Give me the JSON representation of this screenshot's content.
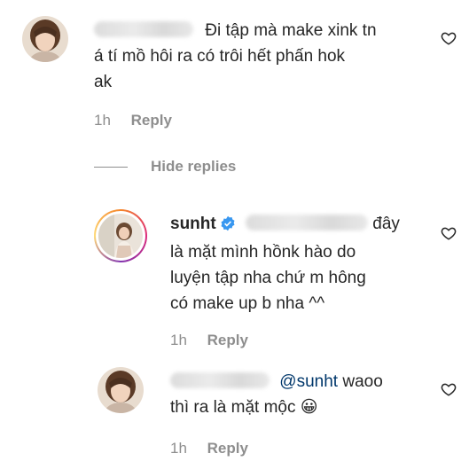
{
  "comments": [
    {
      "username": "",
      "text_lines": [
        "Đi tập mà make xink tn",
        "á tí mồ hôi ra có trôi hết phấn hok",
        "ak"
      ],
      "time": "1h",
      "reply_label": "Reply",
      "avatar_icon": "user-avatar-girl"
    }
  ],
  "hide_replies_label": "Hide replies",
  "replies": [
    {
      "username": "sunht",
      "verified": true,
      "text_lines": [
        "đây",
        "là mặt mình hồnk hào do",
        "luyện tập nha chứ m hông",
        "có make up b nha ^^"
      ],
      "time": "1h",
      "reply_label": "Reply"
    },
    {
      "mention": "@sunht",
      "text_after_mention": "waoo",
      "text_line2": "thì ra là mặt mộc 😀",
      "time": "1h",
      "reply_label": "Reply"
    }
  ],
  "colors": {
    "text": "#262626",
    "meta": "#8e8e8e",
    "mention": "#00376b",
    "verified": "#3897f0"
  }
}
